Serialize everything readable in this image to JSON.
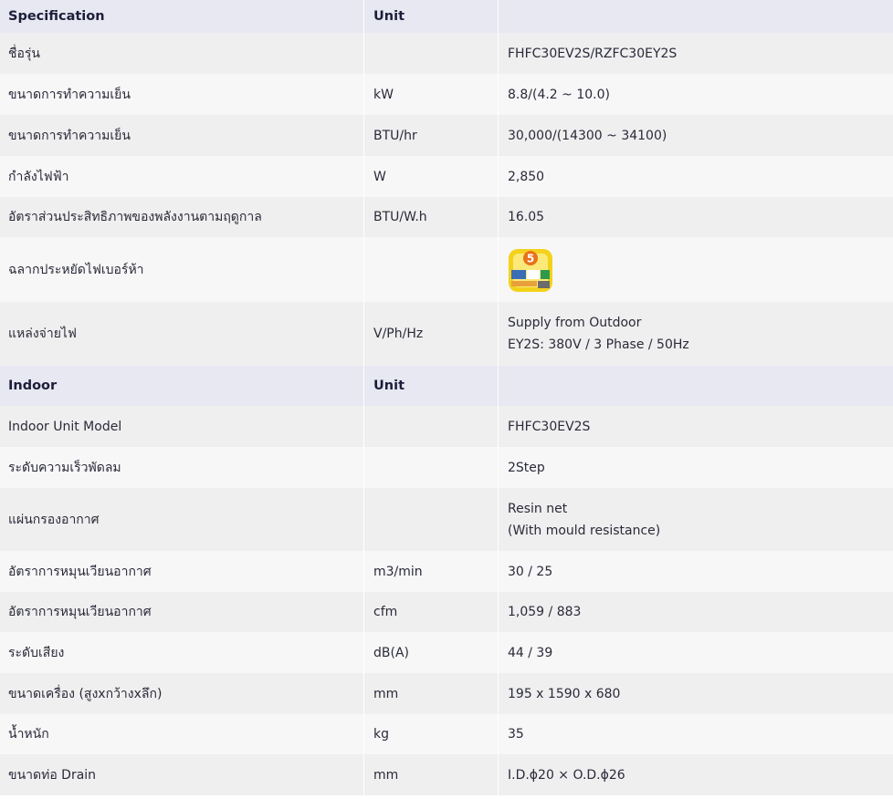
{
  "spec_header": {
    "col1": "Specification",
    "col2": "Unit",
    "col3": ""
  },
  "spec_rows": [
    {
      "name": "ชื่อรุ่น",
      "unit": "",
      "value": "FHFC30EV2S/RZFC30EY2S"
    },
    {
      "name": "ขนาดการทำความเย็น",
      "unit": "kW",
      "value": "8.8/(4.2 ~ 10.0)"
    },
    {
      "name": "ขนาดการทำความเย็น",
      "unit": "BTU/hr",
      "value": "30,000/(14300 ~ 34100)"
    },
    {
      "name": "กำลังไฟฟ้า",
      "unit": "W",
      "value": "2,850"
    },
    {
      "name": "อัตราส่วนประสิทธิภาพของพลังงานตามฤดูกาล",
      "unit": "BTU/W.h",
      "value": "16.05"
    },
    {
      "name": "ฉลากประหยัดไฟเบอร์ห้า",
      "unit": "",
      "value_image": "energy-label-no5-icon",
      "badge_number": "5"
    },
    {
      "name": "แหล่งจ่ายไฟ",
      "unit": "V/Ph/Hz",
      "value_lines": [
        "Supply from Outdoor",
        "EY2S: 380V / 3 Phase / 50Hz"
      ]
    }
  ],
  "indoor_header": {
    "col1": "Indoor",
    "col2": "Unit",
    "col3": ""
  },
  "indoor_rows": [
    {
      "name": "Indoor Unit Model",
      "unit": "",
      "value": "FHFC30EV2S"
    },
    {
      "name": "ระดับความเร็วพัดลม",
      "unit": "",
      "value": "2Step"
    },
    {
      "name": "แผ่นกรองอากาศ",
      "unit": "",
      "value_lines": [
        "Resin net",
        "(With mould resistance)"
      ]
    },
    {
      "name": "อัตราการหมุนเวียนอากาศ",
      "unit": "m3/min",
      "value": "30 / 25"
    },
    {
      "name": "อัตราการหมุนเวียนอากาศ",
      "unit": "cfm",
      "value": "1,059 / 883"
    },
    {
      "name": "ระดับเสียง",
      "unit": "dB(A)",
      "value": "44 / 39"
    },
    {
      "name": "ขนาดเครื่อง (สูงxกว้างxลึก)",
      "unit": "mm",
      "value": "195 x 1590 x 680"
    },
    {
      "name": "น้ำหนัก",
      "unit": "kg",
      "value": "35"
    },
    {
      "name": "ขนาดท่อ Drain",
      "unit": "mm",
      "value": "I.D.ϕ20 × O.D.ϕ26"
    }
  ],
  "colors": {
    "header_bg": "#e7e8f1",
    "row_odd": "#efefef",
    "row_even": "#f7f7f7",
    "text": "#2a2a3a",
    "label_yellow": "#f3d21c",
    "label_orange": "#e8711a"
  }
}
